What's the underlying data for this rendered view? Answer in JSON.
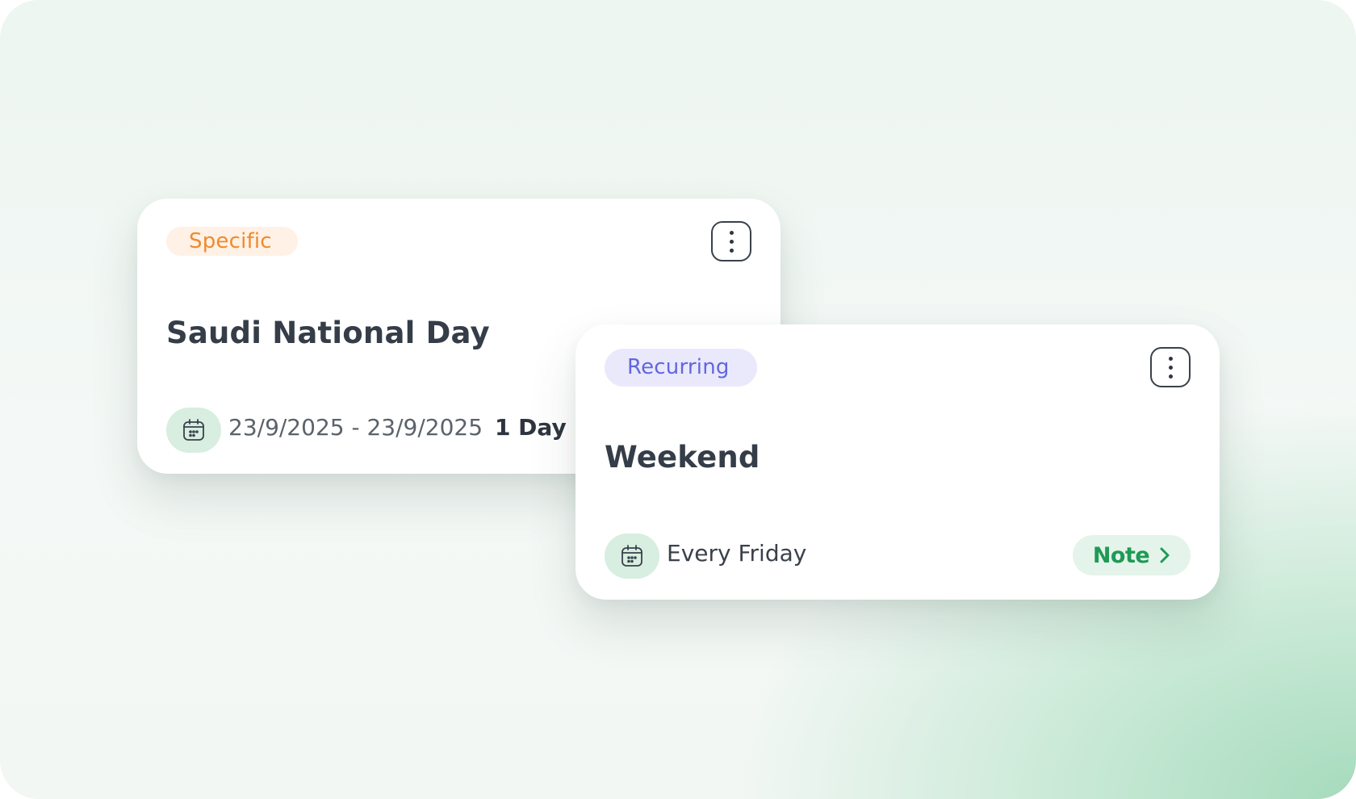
{
  "colors": {
    "specific_tag_text": "#f08a2c",
    "specific_tag_bg": "#fff1e6",
    "recurring_tag_text": "#6366e0",
    "recurring_tag_bg": "#e9e9fb",
    "note_accent": "#1f9a55",
    "title_text": "#343d48"
  },
  "cards": [
    {
      "tag": "Specific",
      "title": "Saudi National Day",
      "date_range": "23/9/2025 - 23/9/2025",
      "duration": "1 Day",
      "icon": "calendar-icon",
      "menu_icon": "more-vertical-icon"
    },
    {
      "tag": "Recurring",
      "title": "Weekend",
      "schedule": "Every Friday",
      "icon": "calendar-icon",
      "menu_icon": "more-vertical-icon",
      "note_label": "Note",
      "note_icon": "chevron-right-icon"
    }
  ]
}
